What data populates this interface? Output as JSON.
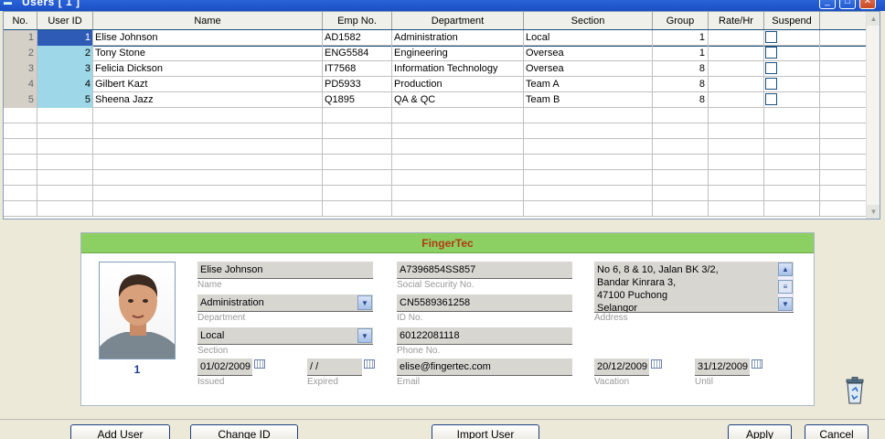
{
  "window": {
    "title": "Users   [ 1 ]"
  },
  "grid": {
    "columns": [
      "No.",
      "User ID",
      "Name",
      "Emp No.",
      "Department",
      "Section",
      "Group",
      "Rate/Hr",
      "Suspend"
    ],
    "rows": [
      {
        "no": "1",
        "user_id": "1",
        "name": "Elise Johnson",
        "emp_no": "AD1582",
        "department": "Administration",
        "section": "Local",
        "group": "1",
        "rate": "",
        "suspend": false
      },
      {
        "no": "2",
        "user_id": "2",
        "name": "Tony Stone",
        "emp_no": "ENG5584",
        "department": "Engineering",
        "section": "Oversea",
        "group": "1",
        "rate": "",
        "suspend": false
      },
      {
        "no": "3",
        "user_id": "3",
        "name": "Felicia Dickson",
        "emp_no": "IT7568",
        "department": "Information Technology",
        "section": "Oversea",
        "group": "8",
        "rate": "",
        "suspend": false
      },
      {
        "no": "4",
        "user_id": "4",
        "name": "Gilbert Kazt",
        "emp_no": "PD5933",
        "department": "Production",
        "section": "Team A",
        "group": "8",
        "rate": "",
        "suspend": false
      },
      {
        "no": "5",
        "user_id": "5",
        "name": "Sheena Jazz",
        "emp_no": "Q1895",
        "department": "QA & QC",
        "section": "Team B",
        "group": "8",
        "rate": "",
        "suspend": false
      }
    ]
  },
  "detail": {
    "brand": "FingerTec",
    "user_id": "1",
    "name": {
      "value": "Elise Johnson",
      "label": "Name"
    },
    "department": {
      "value": "Administration",
      "label": "Department"
    },
    "section": {
      "value": "Local",
      "label": "Section"
    },
    "issued": {
      "value": "01/02/2009",
      "label": "Issued"
    },
    "expired": {
      "value": " /  /",
      "label": "Expired"
    },
    "ssn": {
      "value": "A7396854SS857",
      "label": "Social Security No."
    },
    "id_no": {
      "value": "CN5589361258",
      "label": "ID No."
    },
    "phone": {
      "value": "60122081118",
      "label": "Phone No."
    },
    "email": {
      "value": "elise@fingertec.com",
      "label": "Email"
    },
    "address": {
      "lines": [
        "No 6, 8 & 10, Jalan BK 3/2,",
        "Bandar Kinrara 3,",
        "47100 Puchong",
        "Selangor"
      ],
      "label": "Address"
    },
    "vacation": {
      "value": "20/12/2009",
      "label": "Vacation"
    },
    "until": {
      "value": "31/12/2009",
      "label": "Until"
    }
  },
  "buttons": {
    "add_user": "Add User",
    "change_id": "Change ID",
    "import_user": "Import User",
    "apply": "Apply",
    "cancel": "Cancel"
  },
  "colors": {
    "title_bar": "#1c4fc4",
    "panel_header": "#8ccf63",
    "brand_text": "#b13a13",
    "selected_id": "#2e5bb6",
    "id_cell": "#9ed8e8"
  }
}
